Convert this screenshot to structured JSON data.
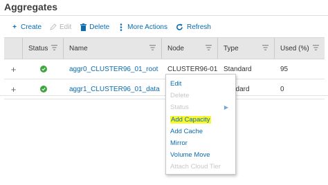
{
  "page": {
    "title": "Aggregates"
  },
  "toolbar": {
    "create": "Create",
    "edit": "Edit",
    "delete": "Delete",
    "more_actions": "More Actions",
    "refresh": "Refresh"
  },
  "table": {
    "headers": {
      "status": "Status",
      "name": "Name",
      "node": "Node",
      "type": "Type",
      "used": "Used (%)"
    },
    "rows": [
      {
        "name": "aggr0_CLUSTER96_01_root",
        "node": "CLUSTER96-01",
        "type": "Standard",
        "used": "95",
        "status": "ok"
      },
      {
        "name": "aggr1_CLUSTER96_01_data",
        "node": "",
        "type": "ndard",
        "used": "0",
        "status": "ok"
      }
    ]
  },
  "context_menu": {
    "items": [
      {
        "label": "Edit",
        "enabled": true
      },
      {
        "label": "Delete",
        "enabled": false
      },
      {
        "label": "Status",
        "enabled": false,
        "submenu": true
      },
      {
        "label": "Add Capacity",
        "enabled": true,
        "highlighted": true
      },
      {
        "label": "Add Cache",
        "enabled": true
      },
      {
        "label": "Mirror",
        "enabled": true
      },
      {
        "label": "Volume Move",
        "enabled": true
      },
      {
        "label": "Attach Cloud Tier",
        "enabled": false
      }
    ]
  },
  "colors": {
    "link": "#0a6bb0",
    "highlight": "#f9f72e",
    "status_ok": "#3ea63c",
    "header_bg": "#e6e6e6"
  }
}
